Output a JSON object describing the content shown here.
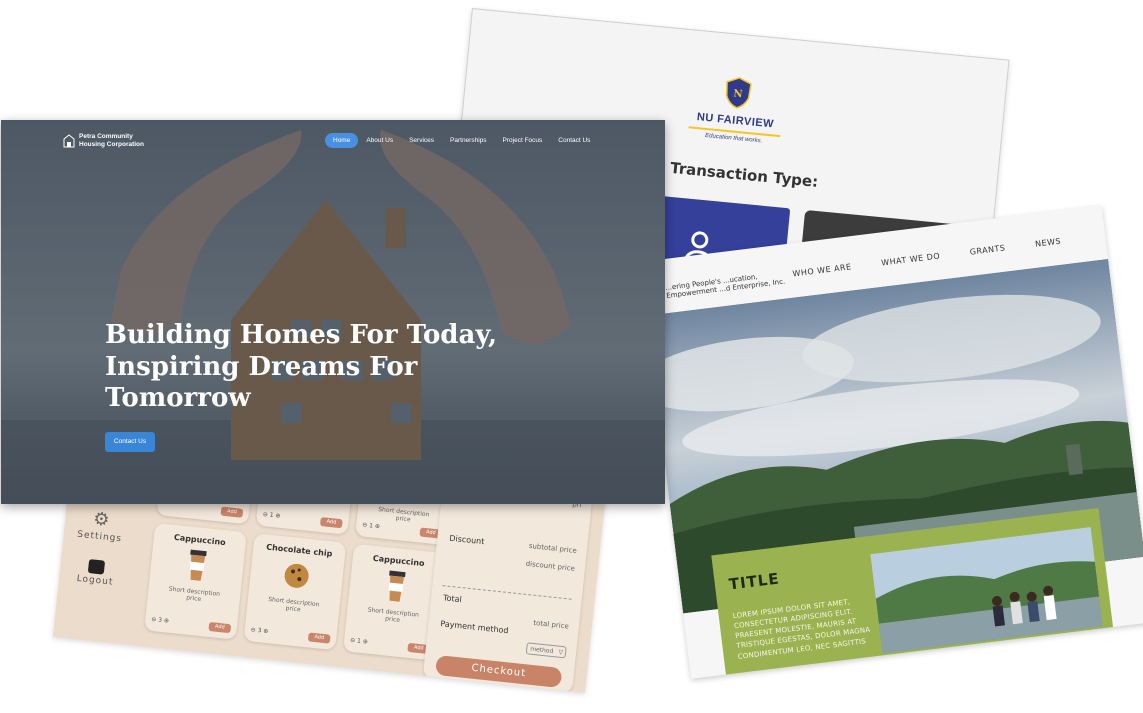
{
  "nu_fairview": {
    "name": "NU FAIRVIEW",
    "tagline": "Education that works.",
    "heading": "elect Transaction Type:"
  },
  "pos_app": {
    "nav": {
      "settings": "Settings",
      "logout": "Logout"
    },
    "items": [
      {
        "name": "",
        "desc": "",
        "price": "price",
        "qty": "",
        "add": "Add"
      },
      {
        "name": "",
        "desc": "",
        "price": "price",
        "qty": "1",
        "add": "Add"
      },
      {
        "name": "",
        "desc": "Short description",
        "price": "price",
        "qty": "1",
        "add": "Add"
      },
      {
        "name": "Cappuccino",
        "desc": "Short description",
        "price": "price",
        "qty": "3",
        "add": "Add"
      },
      {
        "name": "Chocolate chip",
        "desc": "Short description",
        "price": "price",
        "qty": "3",
        "add": "Add"
      },
      {
        "name": "Cappuccino",
        "desc": "Short description",
        "price": "price",
        "qty": "1",
        "add": "Add"
      }
    ],
    "summary": {
      "top_price": "pri",
      "discount_label": "Discount",
      "subtotal_price": "subtotal price",
      "discount_price": "discount price",
      "total_label": "Total",
      "total_price": "total price",
      "payment_label": "Payment method",
      "method": "method",
      "checkout": "Checkout"
    }
  },
  "grants_site": {
    "org": "...ering People's ...ucation, Empowerment ...d Enterprise, Inc.",
    "nav": [
      "WHO WE ARE",
      "WHAT WE DO",
      "GRANTS",
      "NEWS"
    ],
    "title": "TITLE",
    "body": "Lorem ipsum dolor sit amet, consectetur adipiscing elit. Praesent molestie, mauris at tristique egestas, dolor magna condimentum leo, nec sagittis"
  },
  "petra": {
    "brand_line1": "Petra Community",
    "brand_line2": "Housing Corporation",
    "nav": [
      "Home",
      "About Us",
      "Services",
      "Partnerships",
      "Project Focus",
      "Contact Us"
    ],
    "active_nav": "Home",
    "headline_line1": "Building Homes For Today,",
    "headline_line2": "Inspiring Dreams For",
    "headline_line3": "Tomorrow",
    "cta": "Contact Us"
  },
  "colors": {
    "petra_active": "#4a90e2",
    "nu_blue": "#34409a",
    "nu_gold": "#f3c623",
    "pos_bg": "#ecdccb",
    "pos_checkout": "#c98468",
    "grants_green": "#9ab24f"
  }
}
